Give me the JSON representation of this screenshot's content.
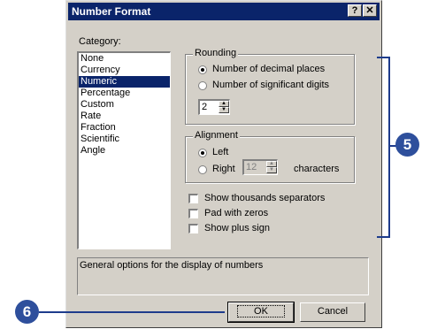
{
  "window": {
    "title": "Number Format",
    "help_glyph": "?",
    "close_glyph": "✕"
  },
  "category": {
    "label": "Category:",
    "items": [
      "None",
      "Currency",
      "Numeric",
      "Percentage",
      "Custom",
      "Rate",
      "Fraction",
      "Scientific",
      "Angle"
    ],
    "selected": "Numeric"
  },
  "rounding": {
    "title": "Rounding",
    "option_decimal": "Number of decimal places",
    "option_significant": "Number of significant digits",
    "selected": "decimal",
    "value": "2"
  },
  "alignment": {
    "title": "Alignment",
    "option_left": "Left",
    "option_right": "Right",
    "selected": "left",
    "characters_value": "12",
    "characters_label": "characters"
  },
  "checkboxes": {
    "thousands": "Show thousands separators",
    "pad_zeros": "Pad with zeros",
    "plus_sign": "Show plus sign"
  },
  "description": "General options for the display of numbers",
  "buttons": {
    "ok": "OK",
    "cancel": "Cancel"
  },
  "callouts": {
    "five": "5",
    "six": "6"
  },
  "colors": {
    "title_bar": "#0a246a",
    "dialog_bg": "#d4d0c8",
    "callout": "#2e4f9c"
  }
}
